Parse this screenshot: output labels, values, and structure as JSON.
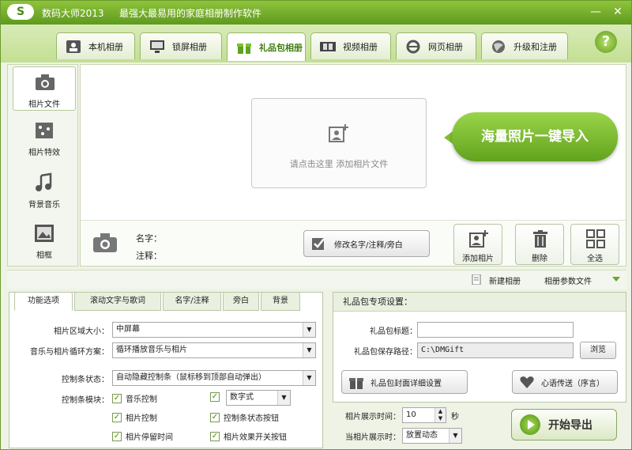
{
  "title_bar": {
    "logo_text": "S",
    "app_name": "数码大师2013",
    "slogan": "最强大最易用的家庭相册制作软件",
    "controls": [
      "—",
      "✕"
    ]
  },
  "tabs": [
    {
      "label": "本机相册",
      "icon": "album-icon"
    },
    {
      "label": "锁屏相册",
      "icon": "monitor-icon"
    },
    {
      "label": "礼品包相册",
      "icon": "gift-icon",
      "active": true
    },
    {
      "label": "视频相册",
      "icon": "film-icon"
    },
    {
      "label": "网页相册",
      "icon": "ie-icon"
    },
    {
      "label": "升级和注册",
      "icon": "globe-icon"
    }
  ],
  "help_label": "?",
  "sidebar": {
    "items": [
      {
        "label": "相片文件",
        "icon": "camera-icon",
        "active": true
      },
      {
        "label": "相片特效",
        "icon": "effects-icon"
      },
      {
        "label": "背景音乐",
        "icon": "music-icon"
      },
      {
        "label": "相框",
        "icon": "frame-icon"
      }
    ]
  },
  "main": {
    "dropzone_label": "请点击这里 添加相片文件",
    "callout_text": "海量照片一键导入",
    "name_label": "名字：",
    "note_label": "注释：",
    "edit_button": "修改名字/注释/旁白",
    "actions": [
      {
        "label": "添加相片",
        "icon": "add-photo-icon"
      },
      {
        "label": "删除",
        "icon": "trash-icon"
      },
      {
        "label": "全选",
        "icon": "select-all-icon"
      }
    ]
  },
  "separator": {
    "new_album": "新建相册",
    "album_params": "相册参数文件"
  },
  "options_panel": {
    "tabs": [
      "功能选项",
      "滚动文字与歌词",
      "名字/注释",
      "旁白",
      "背景"
    ],
    "photo_area_label": "相片区域大小：",
    "photo_area_value": "中屏幕",
    "loop_label": "音乐与相片循环方案：",
    "loop_value": "循环播放音乐与相片",
    "control_state_label": "控制条状态：",
    "control_state_value": "自动隐藏控制条（鼠标移到顶部自动弹出）",
    "control_module_label": "控制条模块：",
    "checks": [
      {
        "label": "音乐控制",
        "checked": true
      },
      {
        "label": "数字式",
        "checked": true
      },
      {
        "label": "相片控制",
        "checked": true
      },
      {
        "label": "控制条状态按钮",
        "checked": true
      },
      {
        "label": "相片停留时间",
        "checked": true
      },
      {
        "label": "相片效果开关按钮",
        "checked": true
      }
    ]
  },
  "gift_panel": {
    "header": "礼品包专项设置：",
    "title_label": "礼品包标题：",
    "title_value": "",
    "path_label": "礼品包保存路径：",
    "path_value": "C:\\DMGift",
    "browse_button": "浏览",
    "cover_button": "礼品包封面详细设置",
    "message_button": "心语传送（序言）"
  },
  "bottom": {
    "display_time_label": "相片展示时间：",
    "display_time_value": "10",
    "display_time_unit": "秒",
    "during_label": "当相片展示时：",
    "during_value": "放置动态",
    "start_button": "开始导出"
  },
  "colors": {
    "accent": "#5e9a1e",
    "accent_light": "#9ad44a",
    "active_tab_text": "#3f7d0e"
  }
}
